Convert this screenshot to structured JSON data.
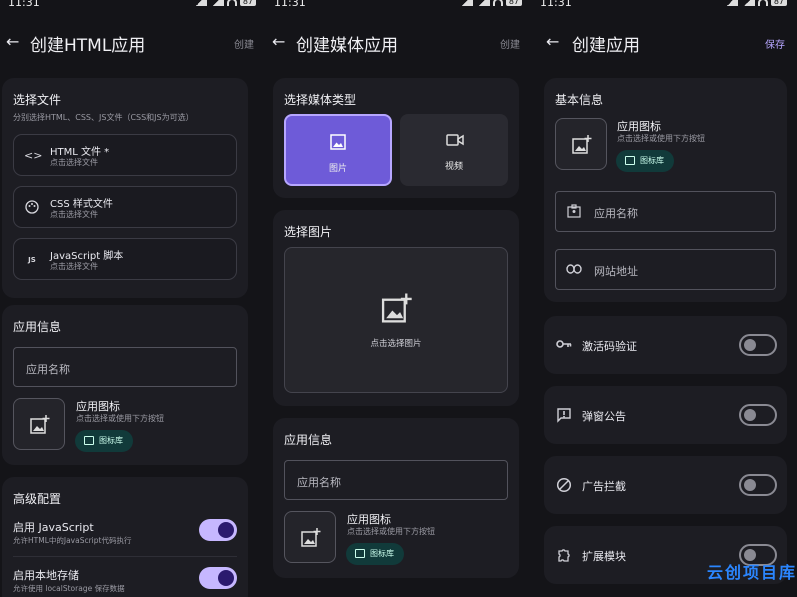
{
  "status": {
    "time": "11:31",
    "battery": "87"
  },
  "screen1": {
    "title": "创建HTML应用",
    "action": "创建",
    "file_card": {
      "title": "选择文件",
      "hint": "分别选择HTML、CSS、JS文件（CSS和JS为可选）",
      "files": [
        {
          "icon": "code-icon",
          "label": "HTML 文件 *",
          "sub": "点击选择文件"
        },
        {
          "icon": "palette-icon",
          "label": "CSS 样式文件",
          "sub": "点击选择文件"
        },
        {
          "icon": "js-icon",
          "icon_text": "JS",
          "label": "JavaScript 脚本",
          "sub": "点击选择文件"
        }
      ]
    },
    "app_card": {
      "title": "应用信息",
      "name_placeholder": "应用名称",
      "icon_label": "应用图标",
      "icon_hint": "点击选择或使用下方按钮",
      "library": "图标库"
    },
    "adv_card": {
      "title": "高级配置",
      "js_label": "启用 JavaScript",
      "js_hint": "允许HTML中的JavaScript代码执行",
      "js_on": true,
      "storage_label": "启用本地存储",
      "storage_hint": "允许使用 localStorage 保存数据",
      "storage_on": true
    }
  },
  "screen2": {
    "title": "创建媒体应用",
    "action": "创建",
    "type_card": {
      "title": "选择媒体类型",
      "image": "图片",
      "video": "视频",
      "selected": "图片"
    },
    "pick_card": {
      "title": "选择图片",
      "hint": "点击选择图片"
    },
    "app_card": {
      "title": "应用信息",
      "name_placeholder": "应用名称",
      "icon_label": "应用图标",
      "icon_hint": "点击选择或使用下方按钮",
      "library": "图标库"
    }
  },
  "screen3": {
    "title": "创建应用",
    "action": "保存",
    "basic_card": {
      "title": "基本信息",
      "icon_label": "应用图标",
      "icon_hint": "点击选择或使用下方按钮",
      "library": "图标库",
      "name_placeholder": "应用名称",
      "url_placeholder": "网站地址"
    },
    "settings": [
      {
        "icon": "key-icon",
        "label": "激活码验证",
        "on": false
      },
      {
        "icon": "announcement-icon",
        "label": "弹窗公告",
        "on": false
      },
      {
        "icon": "block-icon",
        "label": "广告拦截",
        "on": false
      },
      {
        "icon": "extension-icon",
        "label": "扩展模块",
        "on": false
      }
    ]
  },
  "watermark": "云创项目库"
}
